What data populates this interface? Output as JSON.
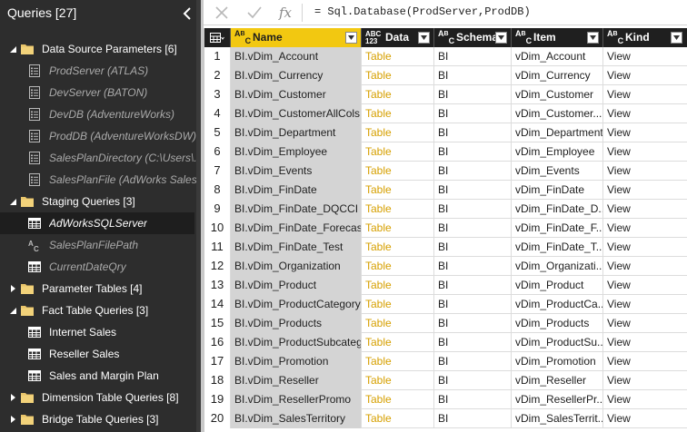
{
  "queries_pane": {
    "title": "Queries [27]",
    "tree": [
      {
        "type": "group",
        "label": "Data Source Parameters [6]",
        "expanded": true
      },
      {
        "type": "param",
        "icon": "parameter-icon",
        "label": "ProdServer (ATLAS)"
      },
      {
        "type": "param",
        "icon": "parameter-icon",
        "label": "DevServer (BATON)"
      },
      {
        "type": "param",
        "icon": "parameter-icon",
        "label": "DevDB (AdventureWorks)"
      },
      {
        "type": "param",
        "icon": "parameter-icon",
        "label": "ProdDB (AdventureWorksDW)"
      },
      {
        "type": "param",
        "icon": "parameter-icon",
        "label": "SalesPlanDirectory (C:\\Users\\..."
      },
      {
        "type": "param",
        "icon": "parameter-icon",
        "label": "SalesPlanFile (AdWorks Sales..."
      },
      {
        "type": "group",
        "label": "Staging Queries [3]",
        "expanded": true
      },
      {
        "type": "query-selected",
        "icon": "table-icon",
        "label": "AdWorksSQLServer"
      },
      {
        "type": "param",
        "icon": "text-type-icon",
        "label": "SalesPlanFilePath"
      },
      {
        "type": "param",
        "icon": "table-icon",
        "label": "CurrentDateQry"
      },
      {
        "type": "group",
        "label": "Parameter Tables [4]",
        "expanded": false
      },
      {
        "type": "group",
        "label": "Fact Table Queries [3]",
        "expanded": true
      },
      {
        "type": "query",
        "icon": "table-icon",
        "label": "Internet Sales"
      },
      {
        "type": "query",
        "icon": "table-icon",
        "label": "Reseller Sales"
      },
      {
        "type": "query",
        "icon": "table-icon",
        "label": "Sales and Margin Plan"
      },
      {
        "type": "group",
        "label": "Dimension Table Queries [8]",
        "expanded": false
      },
      {
        "type": "group",
        "label": "Bridge Table Queries [3]",
        "expanded": false
      }
    ]
  },
  "formula_bar": {
    "fx": "fx",
    "formula": "= Sql.Database(ProdServer,ProdDB)"
  },
  "grid": {
    "columns": [
      {
        "key": "name",
        "type_icon": "ABC",
        "label": "Name"
      },
      {
        "key": "data",
        "type_icon": "ABC123",
        "label": "Data"
      },
      {
        "key": "schema",
        "type_icon": "ABC",
        "label": "Schema"
      },
      {
        "key": "item",
        "type_icon": "ABC",
        "label": "Item"
      },
      {
        "key": "kind",
        "type_icon": "ABC",
        "label": "Kind"
      }
    ],
    "rows": [
      {
        "n": "1",
        "name": "BI.vDim_Account",
        "data": "Table",
        "schema": "BI",
        "item": "vDim_Account",
        "kind": "View"
      },
      {
        "n": "2",
        "name": "BI.vDim_Currency",
        "data": "Table",
        "schema": "BI",
        "item": "vDim_Currency",
        "kind": "View"
      },
      {
        "n": "3",
        "name": "BI.vDim_Customer",
        "data": "Table",
        "schema": "BI",
        "item": "vDim_Customer",
        "kind": "View"
      },
      {
        "n": "4",
        "name": "BI.vDim_CustomerAllCols",
        "data": "Table",
        "schema": "BI",
        "item": "vDim_Customer...",
        "kind": "View"
      },
      {
        "n": "5",
        "name": "BI.vDim_Department",
        "data": "Table",
        "schema": "BI",
        "item": "vDim_Department",
        "kind": "View"
      },
      {
        "n": "6",
        "name": "BI.vDim_Employee",
        "data": "Table",
        "schema": "BI",
        "item": "vDim_Employee",
        "kind": "View"
      },
      {
        "n": "7",
        "name": "BI.vDim_Events",
        "data": "Table",
        "schema": "BI",
        "item": "vDim_Events",
        "kind": "View"
      },
      {
        "n": "8",
        "name": "BI.vDim_FinDate",
        "data": "Table",
        "schema": "BI",
        "item": "vDim_FinDate",
        "kind": "View"
      },
      {
        "n": "9",
        "name": "BI.vDim_FinDate_DQCCI",
        "data": "Table",
        "schema": "BI",
        "item": "vDim_FinDate_D...",
        "kind": "View"
      },
      {
        "n": "10",
        "name": "BI.vDim_FinDate_Forecast",
        "data": "Table",
        "schema": "BI",
        "item": "vDim_FinDate_F...",
        "kind": "View"
      },
      {
        "n": "11",
        "name": "BI.vDim_FinDate_Test",
        "data": "Table",
        "schema": "BI",
        "item": "vDim_FinDate_T...",
        "kind": "View"
      },
      {
        "n": "12",
        "name": "BI.vDim_Organization",
        "data": "Table",
        "schema": "BI",
        "item": "vDim_Organizati...",
        "kind": "View"
      },
      {
        "n": "13",
        "name": "BI.vDim_Product",
        "data": "Table",
        "schema": "BI",
        "item": "vDim_Product",
        "kind": "View"
      },
      {
        "n": "14",
        "name": "BI.vDim_ProductCategory",
        "data": "Table",
        "schema": "BI",
        "item": "vDim_ProductCa...",
        "kind": "View"
      },
      {
        "n": "15",
        "name": "BI.vDim_Products",
        "data": "Table",
        "schema": "BI",
        "item": "vDim_Products",
        "kind": "View"
      },
      {
        "n": "16",
        "name": "BI.vDim_ProductSubcateg...",
        "data": "Table",
        "schema": "BI",
        "item": "vDim_ProductSu...",
        "kind": "View"
      },
      {
        "n": "17",
        "name": "BI.vDim_Promotion",
        "data": "Table",
        "schema": "BI",
        "item": "vDim_Promotion",
        "kind": "View"
      },
      {
        "n": "18",
        "name": "BI.vDim_Reseller",
        "data": "Table",
        "schema": "BI",
        "item": "vDim_Reseller",
        "kind": "View"
      },
      {
        "n": "19",
        "name": "BI.vDim_ResellerPromo",
        "data": "Table",
        "schema": "BI",
        "item": "vDim_ResellerPr...",
        "kind": "View"
      },
      {
        "n": "20",
        "name": "BI.vDim_SalesTerritory",
        "data": "Table",
        "schema": "BI",
        "item": "vDim_SalesTerrit...",
        "kind": "View"
      }
    ]
  },
  "colors": {
    "pane_bg": "#2d2d2d",
    "header_accent": "#f2c811",
    "data_link": "#d6a000",
    "name_col_bg": "#d4d4d4"
  }
}
